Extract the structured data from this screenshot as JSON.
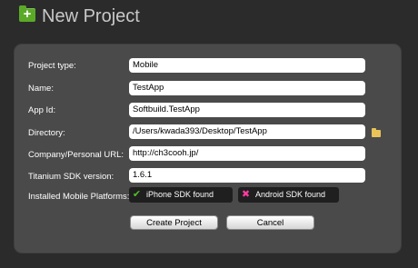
{
  "header": {
    "icon": "folder-add-icon",
    "icon_glyph": "+",
    "title": "New Project"
  },
  "form": {
    "project_type": {
      "label": "Project type:",
      "value": "Mobile"
    },
    "name": {
      "label": "Name:",
      "value": "TestApp"
    },
    "app_id": {
      "label": "App Id:",
      "value": "Softbuild.TestApp"
    },
    "directory": {
      "label": "Directory:",
      "value": "/Users/kwada393/Desktop/TestApp",
      "browse_icon": "folder-browse-icon"
    },
    "url": {
      "label": "Company/Personal URL:",
      "value": "http://ch3cooh.jp/"
    },
    "sdk_version": {
      "label": "Titanium SDK version:",
      "value": "1.6.1"
    },
    "platforms": {
      "label": "Installed Mobile Platforms:",
      "items": [
        {
          "name": "iPhone SDK found",
          "status": "found",
          "icon": "check-icon",
          "glyph": "✔"
        },
        {
          "name": "Android SDK found",
          "status": "found",
          "icon": "cross-icon",
          "glyph": "✖"
        }
      ]
    }
  },
  "buttons": {
    "create": "Create Project",
    "cancel": "Cancel"
  },
  "colors": {
    "background": "#2b2b2b",
    "panel": "#4a4a4a",
    "accent_green": "#5aaa28",
    "check_green": "#4fbf2a",
    "cross_pink": "#ff3ba0"
  }
}
